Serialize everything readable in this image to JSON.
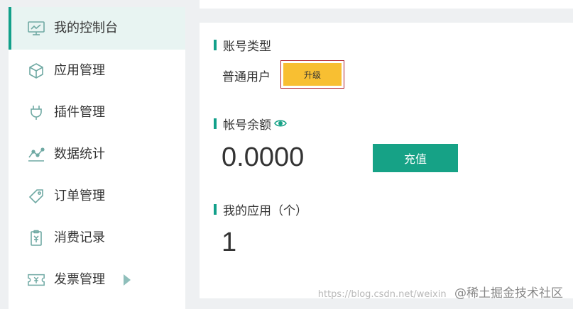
{
  "sidebar": {
    "items": [
      {
        "label": "我的控制台",
        "icon": "monitor-icon",
        "active": true
      },
      {
        "label": "应用管理",
        "icon": "cube-icon",
        "active": false
      },
      {
        "label": "插件管理",
        "icon": "plug-icon",
        "active": false
      },
      {
        "label": "数据统计",
        "icon": "line-chart-icon",
        "active": false
      },
      {
        "label": "订单管理",
        "icon": "tag-icon",
        "active": false
      },
      {
        "label": "消费记录",
        "icon": "receipt-icon",
        "active": false
      },
      {
        "label": "发票管理",
        "icon": "ticket-icon",
        "active": false
      }
    ]
  },
  "account": {
    "type_title": "账号类型",
    "type_value": "普通用户",
    "upgrade_label": "升级",
    "balance_title": "帐号余额",
    "balance_value": "0.0000",
    "recharge_label": "充值",
    "apps_title": "我的应用（个）",
    "apps_count": "1"
  },
  "watermark": {
    "url": "https://blog.csdn.net/weixin",
    "text": "@稀土掘金技术社区"
  },
  "colors": {
    "accent": "#12a08a",
    "upgrade": "#f8bf32",
    "active_bg": "#e8f4f2",
    "icon": "#6fa9a3"
  }
}
